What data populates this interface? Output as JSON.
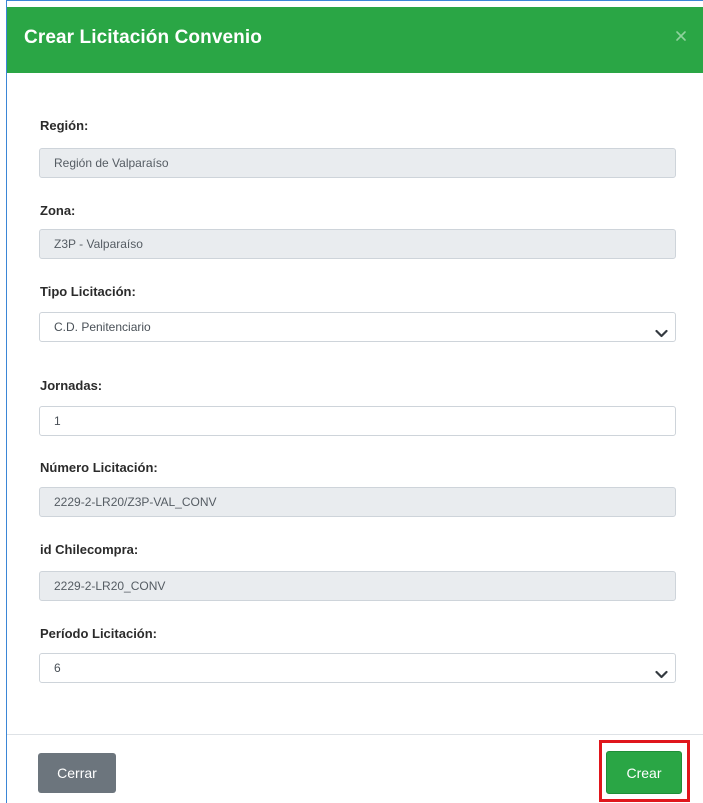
{
  "modal": {
    "title": "Crear Licitación Convenio",
    "colors": {
      "header": "#2aa645",
      "close_button": "#6c757d",
      "create_button": "#2aa645",
      "highlight": "#e0161c"
    }
  },
  "fields": {
    "region": {
      "label": "Región:",
      "value": "Región de Valparaíso",
      "readonly": true
    },
    "zona": {
      "label": "Zona:",
      "value": "Z3P - Valparaíso",
      "readonly": true
    },
    "tipo": {
      "label": "Tipo Licitación:",
      "value": "C.D. Penitenciario",
      "control": "select"
    },
    "jornadas": {
      "label": "Jornadas:",
      "value": "1",
      "control": "text-input"
    },
    "numero": {
      "label": "Número Licitación:",
      "value": "2229-2-LR20/Z3P-VAL_CONV",
      "readonly": true
    },
    "chilecompra": {
      "label": "id Chilecompra:",
      "value": "2229-2-LR20_CONV",
      "readonly": true
    },
    "periodo": {
      "label": "Período Licitación:",
      "value": "6",
      "control": "select"
    }
  },
  "footer": {
    "close_label": "Cerrar",
    "create_label": "Crear"
  },
  "icons": {
    "close": "close-icon",
    "select_arrow": "chevron-down-icon"
  }
}
